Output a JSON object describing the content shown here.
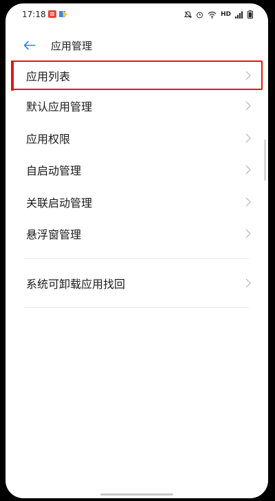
{
  "status_bar": {
    "time": "17:18",
    "network": "HD",
    "notification_icons": [
      "message-notification-icon",
      "app-notification-icon"
    ],
    "system_icons": [
      "mute-icon",
      "alarm-icon",
      "wifi-icon",
      "signal-icon",
      "battery-icon"
    ]
  },
  "header": {
    "title": "应用管理",
    "back_icon": "back-arrow-icon"
  },
  "colors": {
    "accent": "#3a82f0",
    "highlight": "#e5141a",
    "text": "#1a1a1a",
    "chevron": "#bdbdbd"
  },
  "menu": {
    "items": [
      {
        "label": "应用列表"
      },
      {
        "label": "默认应用管理"
      },
      {
        "label": "应用权限"
      },
      {
        "label": "自启动管理"
      },
      {
        "label": "关联启动管理"
      },
      {
        "label": "悬浮窗管理"
      }
    ],
    "secondary": [
      {
        "label": "系统可卸载应用找回"
      }
    ]
  }
}
